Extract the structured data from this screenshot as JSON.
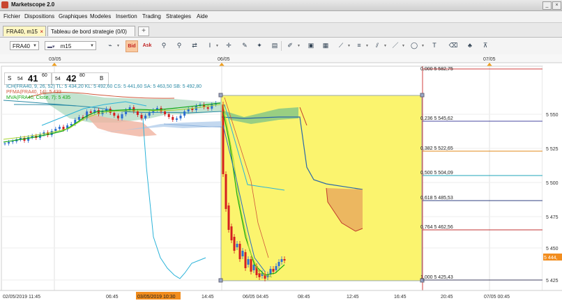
{
  "app": {
    "title": "Marketscope 2.0"
  },
  "menu": [
    "Fichier",
    "Dispositions",
    "Graphiques",
    "Modeles",
    "Insertion",
    "Trading",
    "Strategies",
    "Aide"
  ],
  "tabs": [
    {
      "label": "FRA40, m15",
      "active": true
    },
    {
      "label": "Tableau de bord strategie (0/0)",
      "active": false
    }
  ],
  "toolbar": {
    "symbol": "FRA40",
    "timeframe": "m15",
    "bid_label": "Bid",
    "ask_label": "Ask"
  },
  "quote": {
    "sell_label": "S",
    "sell_small": "54",
    "sell_big": "41",
    "sell_sup": "60",
    "buy_small": "54",
    "buy_big": "42",
    "buy_sup": "80",
    "buy_label": "B"
  },
  "indicators": {
    "ichimoku": "ICH(FRA40, 9, 26, 52)  TL: 5 434,20  KL: 5 492,60  CS: 5 441,60  SA: 5 463,50  SB: 5 492,80",
    "pfma": "PFMA(FRA40, 14): 5 433",
    "ma2": "MVA(FRA40, Close, 7): 5 435"
  },
  "top_axis": [
    "03/05",
    "06/05",
    "07/05"
  ],
  "x_axis": [
    "02/05/2019 11:45",
    "06:45",
    "03/05/2019 10:30",
    "14:45",
    "06/05 04:45",
    "08:45",
    "12:45",
    "16:45",
    "20:45",
    "07/05 00:45"
  ],
  "y_axis": [
    "5 550",
    "5 525",
    "5 500",
    "5 475",
    "5 450",
    "5 425"
  ],
  "fib": [
    {
      "label": "0,000 5 582,75",
      "color": "#d04040"
    },
    {
      "label": "0,236 5 545,62",
      "color": "#4a4aa0"
    },
    {
      "label": "0,382 5 522,65",
      "color": "#e08a1a"
    },
    {
      "label": "0,500 5 504,09",
      "color": "#1fa5b8"
    },
    {
      "label": "0,618 5 485,53",
      "color": "#304080"
    },
    {
      "label": "0,764 5 462,56",
      "color": "#c03030"
    },
    {
      "label": "1,000 5 425,43",
      "color": "#404060"
    }
  ],
  "price_tag": "5 444,",
  "colors": {
    "bull": "#2e6fd1",
    "bear": "#d42020",
    "fib_zone": "#fbf46e",
    "cloud_up": "#9ad1b0",
    "cloud_down": "#f0b3a0"
  }
}
